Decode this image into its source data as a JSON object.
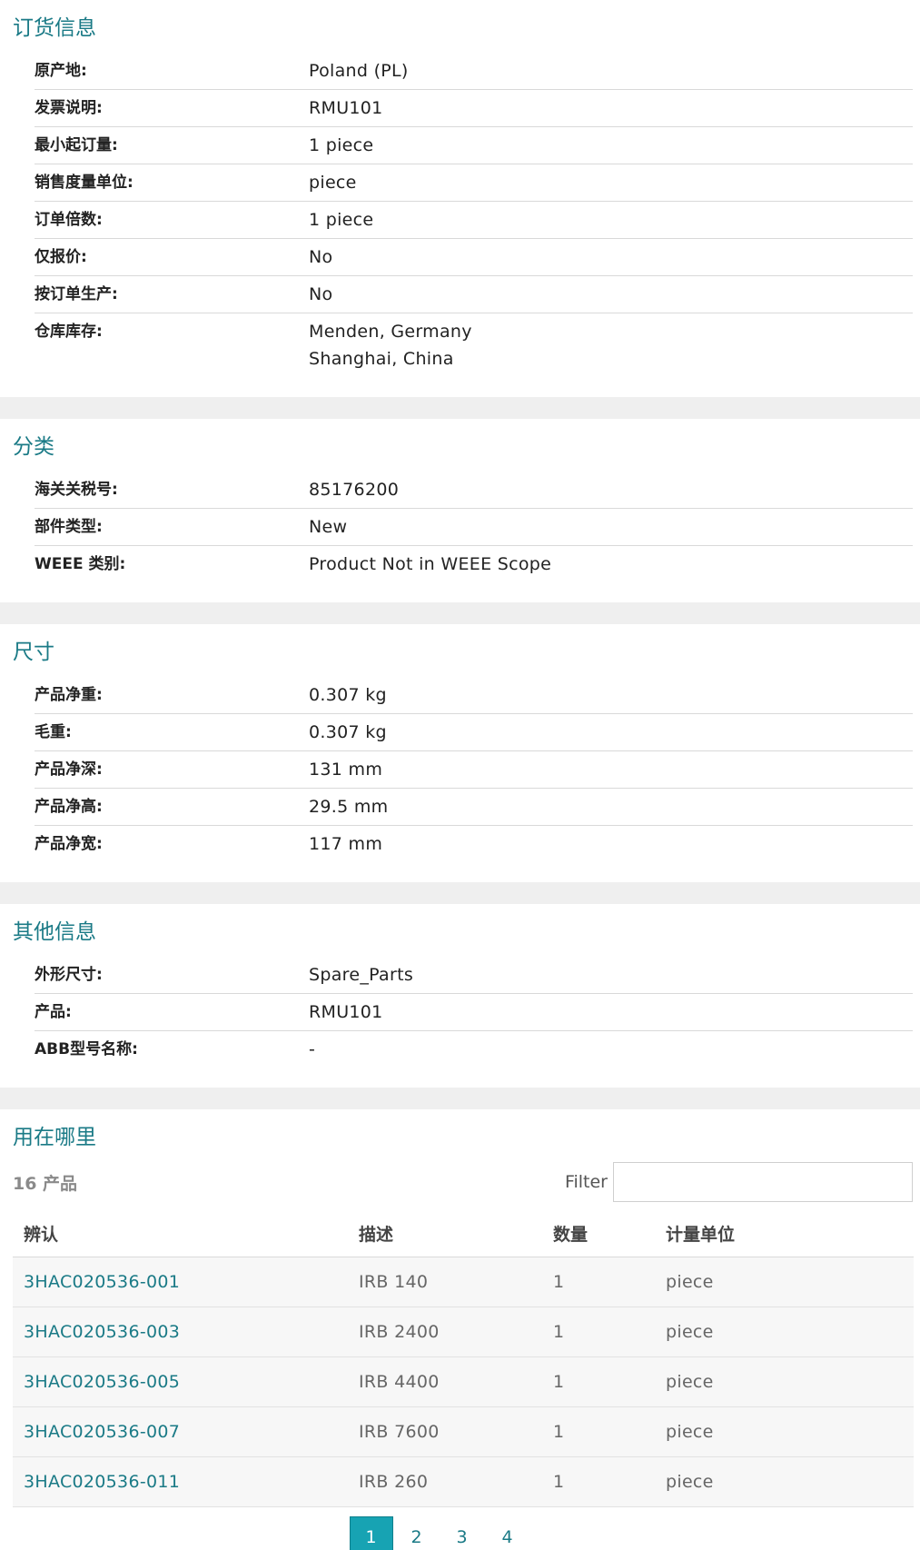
{
  "ordering": {
    "title": "订货信息",
    "rows": [
      {
        "label": "原产地:",
        "values": [
          "Poland (PL)"
        ]
      },
      {
        "label": "发票说明:",
        "values": [
          "RMU101"
        ]
      },
      {
        "label": "最小起订量:",
        "values": [
          "1 piece"
        ]
      },
      {
        "label": "销售度量单位:",
        "values": [
          "piece"
        ]
      },
      {
        "label": "订单倍数:",
        "values": [
          "1 piece"
        ]
      },
      {
        "label": "仅报价:",
        "values": [
          "No"
        ]
      },
      {
        "label": "按订单生产:",
        "values": [
          "No"
        ]
      },
      {
        "label": "仓库库存:",
        "values": [
          "Menden, Germany",
          "Shanghai, China"
        ]
      }
    ]
  },
  "classification": {
    "title": "分类",
    "rows": [
      {
        "label": "海关关税号:",
        "values": [
          "85176200"
        ]
      },
      {
        "label": "部件类型:",
        "values": [
          "New"
        ]
      },
      {
        "label": "WEEE 类别:",
        "values": [
          "Product Not in WEEE Scope"
        ]
      }
    ]
  },
  "dimensions": {
    "title": "尺寸",
    "rows": [
      {
        "label": "产品净重:",
        "values": [
          "0.307 kg"
        ]
      },
      {
        "label": "毛重:",
        "values": [
          "0.307 kg"
        ]
      },
      {
        "label": "产品净深:",
        "values": [
          "131 mm"
        ]
      },
      {
        "label": "产品净高:",
        "values": [
          "29.5 mm"
        ]
      },
      {
        "label": "产品净宽:",
        "values": [
          "117 mm"
        ]
      }
    ]
  },
  "other": {
    "title": "其他信息",
    "rows": [
      {
        "label": "外形尺寸:",
        "values": [
          "Spare_Parts"
        ]
      },
      {
        "label": "产品:",
        "values": [
          "RMU101"
        ]
      },
      {
        "label": "ABB型号名称:",
        "values": [
          "-"
        ]
      }
    ]
  },
  "where_used": {
    "title": "用在哪里",
    "count": "16 产品",
    "filter_label": "Filter",
    "filter_value": "",
    "columns": [
      "辨认",
      "描述",
      "数量",
      "计量单位"
    ],
    "rows": [
      [
        "3HAC020536-001",
        "IRB 140",
        "1",
        "piece"
      ],
      [
        "3HAC020536-003",
        "IRB 2400",
        "1",
        "piece"
      ],
      [
        "3HAC020536-005",
        "IRB 4400",
        "1",
        "piece"
      ],
      [
        "3HAC020536-007",
        "IRB 7600",
        "1",
        "piece"
      ],
      [
        "3HAC020536-011",
        "IRB 260",
        "1",
        "piece"
      ]
    ],
    "pages": [
      "1",
      "2",
      "3",
      "4"
    ],
    "active_page": "1"
  },
  "colors": {
    "accent": "#1a7a86",
    "active_page_bg": "#17a3b3",
    "section_gap": "#efefef"
  }
}
